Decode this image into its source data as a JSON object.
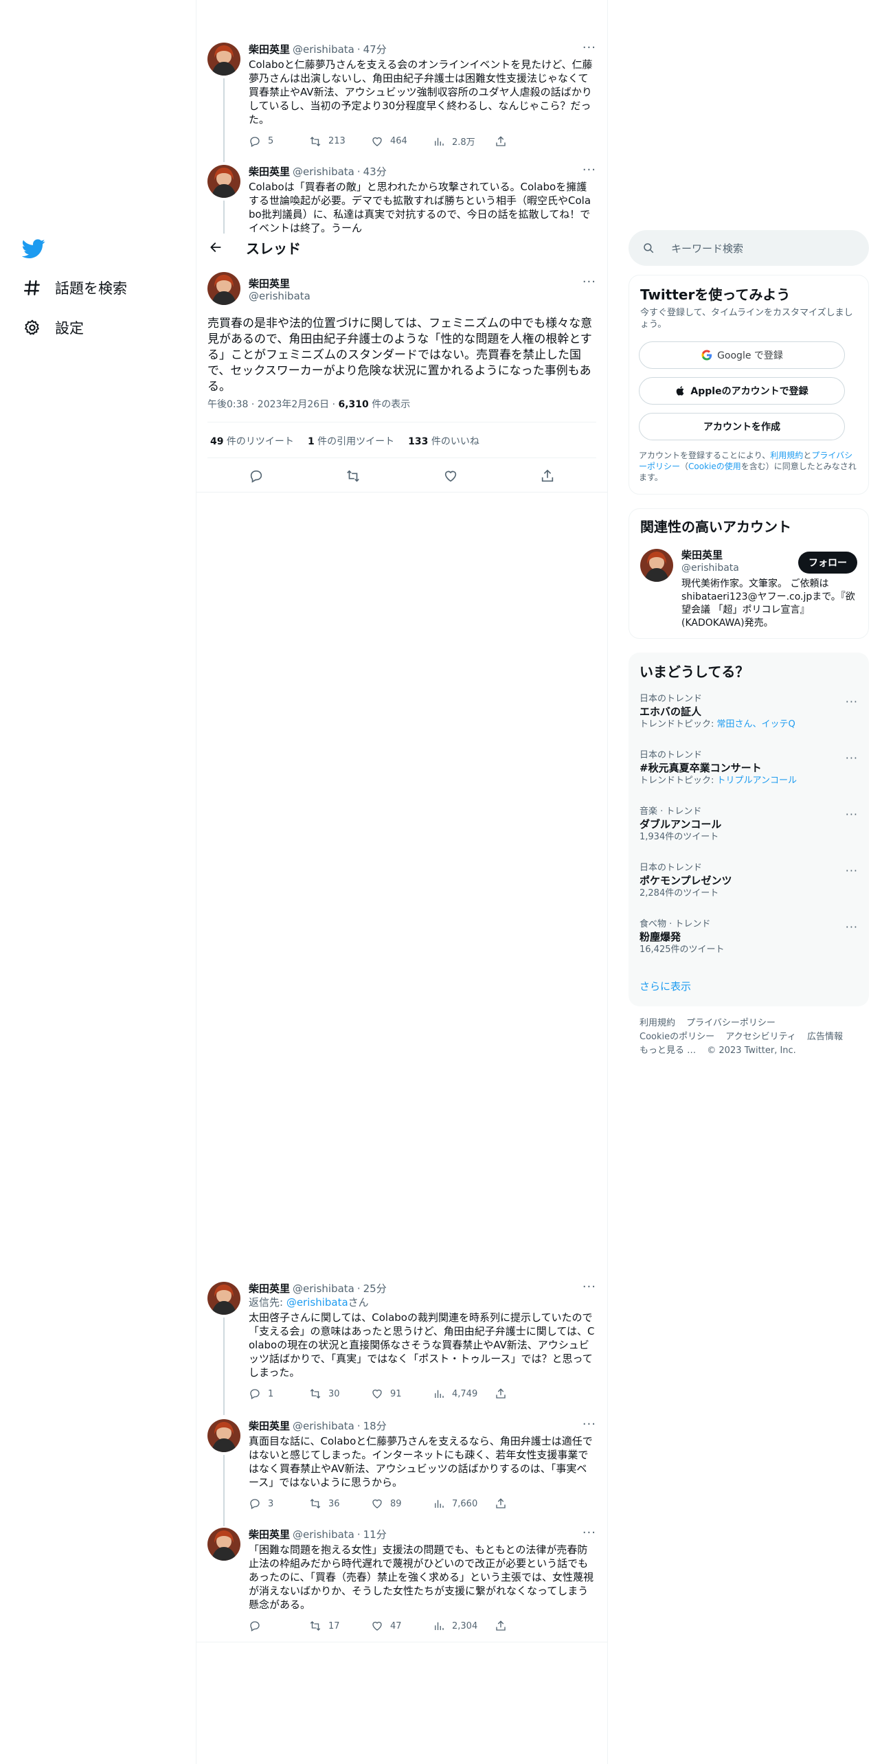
{
  "nav": {
    "explore_label": "話題を検索",
    "settings_label": "設定"
  },
  "thread_header": {
    "title": "スレッド"
  },
  "prev_tweets": [
    {
      "name": "柴田英里",
      "handle": "@erishibata",
      "dot": "·",
      "time": "47分",
      "text": "Colaboと仁藤夢乃さんを支える会のオンラインイベントを見たけど、仁藤夢乃さんは出演しないし、角田由紀子弁護士は困難女性支援法じゃなくて買春禁止やAV新法、アウシュビッツ強制収容所のユダヤ人虐殺の話ばかりしているし、当初の予定より30分程度早く終わるし、なんじゃこら？だった。",
      "replies": "5",
      "retweets": "213",
      "likes": "464",
      "views": "2.8万"
    },
    {
      "name": "柴田英里",
      "handle": "@erishibata",
      "dot": "·",
      "time": "43分",
      "text": "Colaboは「買春者の敵」と思われたから攻撃されている。Colaboを擁護する世論喚起が必要。デマでも拡散すれば勝ちという相手（暇空氏やColabo批判議員）に、私達は真実で対抗するので、今日の話を拡散してね！でイベントは終了。うーん"
    }
  ],
  "main_tweet": {
    "name": "柴田英里",
    "handle": "@erishibata",
    "text": "売買春の是非や法的位置づけに関しては、フェミニズムの中でも様々な意見があるので、角田由紀子弁護士のような「性的な問題を人権の根幹とする」ことがフェミニズムのスタンダードではない。売買春を禁止した国で、セックスワーカーがより危険な状況に置かれるようになった事例もある。",
    "time": "午後0:38 · 2023年2月26日 · ",
    "views": "6,310",
    "views_label": " 件の表示",
    "retweets": "49",
    "retweets_label": " 件のリツイート",
    "quotes": "1",
    "quotes_label": " 件の引用ツイート",
    "likes": "133",
    "likes_label": " 件のいいね"
  },
  "replies": [
    {
      "name": "柴田英里",
      "handle": "@erishibata",
      "dot": "·",
      "time": "25分",
      "reply_prefix": "返信先: ",
      "reply_to": "@erishibata",
      "reply_suffix": "さん",
      "text": "太田啓子さんに関しては、Colaboの裁判関連を時系列に提示していたので「支える会」の意味はあったと思うけど、角田由紀子弁護士に関しては、Colaboの現在の状況と直接関係なさそうな買春禁止やAV新法、アウシュビッツ話ばかりで、「真実」ではなく「ポスト・トゥルース」では？と思ってしまった。",
      "replies": "1",
      "retweets": "30",
      "likes": "91",
      "views": "4,749"
    },
    {
      "name": "柴田英里",
      "handle": "@erishibata",
      "dot": "·",
      "time": "18分",
      "text": "真面目な話に、Colaboと仁藤夢乃さんを支えるなら、角田弁護士は適任ではないと感じてしまった。インターネットにも疎く、若年女性支援事業ではなく買春禁止やAV新法、アウシュビッツの話ばかりするのは、「事実ベース」ではないように思うから。",
      "replies": "3",
      "retweets": "36",
      "likes": "89",
      "views": "7,660"
    },
    {
      "name": "柴田英里",
      "handle": "@erishibata",
      "dot": "·",
      "time": "11分",
      "text": "「困難な問題を抱える女性」支援法の問題でも、もともとの法律が売春防止法の枠組みだから時代遅れで蔑視がひどいので改正が必要という話でもあったのに、「買春（売春）禁止を強く求める」という主張では、女性蔑視が消えないばかりか、そうした女性たちが支援に繋がれなくなってしまう懸念がある。",
      "replies": "",
      "retweets": "17",
      "likes": "47",
      "views": "2,304"
    }
  ],
  "search": {
    "placeholder": "キーワード検索"
  },
  "signup": {
    "title": "Twitterを使ってみよう",
    "subtitle": "今すぐ登録して、タイムラインをカスタマイズしましょう。",
    "google_btn": "Google で登録",
    "apple_btn": "Appleのアカウントで登録",
    "create_btn": "アカウントを作成",
    "terms_prefix": "アカウントを登録することにより、",
    "terms_link": "利用規約",
    "terms_and": "と",
    "privacy_link": "プライバシーポリシー",
    "cookie_open": "（",
    "cookie_link": "Cookieの使用",
    "cookie_close": "を含む）に同意したとみなされます。"
  },
  "related": {
    "title": "関連性の高いアカウント",
    "name": "柴田英里",
    "handle": "@erishibata",
    "follow": "フォロー",
    "bio": "現代美術作家。文筆家。 ご依頼は shibataeri123@ヤフー.co.jpまで。『欲望会議 「超」ポリコレ宣言』(KADOKAWA)発売。"
  },
  "trends": {
    "title": "いまどうしてる？",
    "items": [
      {
        "context": "日本のトレンド",
        "title": "エホバの証人",
        "meta_prefix": "トレンドトピック: ",
        "meta_link": "常田さん、イッテQ"
      },
      {
        "context": "日本のトレンド",
        "title": "#秋元真夏卒業コンサート",
        "meta_prefix": "トレンドトピック: ",
        "meta_link": "トリプルアンコール"
      },
      {
        "context": "音楽 · トレンド",
        "title": "ダブルアンコール",
        "meta_prefix": "1,934件のツイート",
        "meta_link": ""
      },
      {
        "context": "日本のトレンド",
        "title": "ポケモンプレゼンツ",
        "meta_prefix": "2,284件のツイート",
        "meta_link": ""
      },
      {
        "context": "食べ物 · トレンド",
        "title": "粉塵爆発",
        "meta_prefix": "16,425件のツイート",
        "meta_link": ""
      }
    ],
    "show_more": "さらに表示"
  },
  "footer": {
    "terms": "利用規約",
    "privacy": "プライバシーポリシー",
    "cookie": "Cookieのポリシー",
    "accessibility": "アクセシビリティ",
    "ads": "広告情報",
    "more": "もっと見る …",
    "copyright": "© 2023 Twitter, Inc."
  },
  "colors": {
    "accent": "#1d9bf0",
    "text": "#0f1419",
    "secondary": "#536471"
  }
}
